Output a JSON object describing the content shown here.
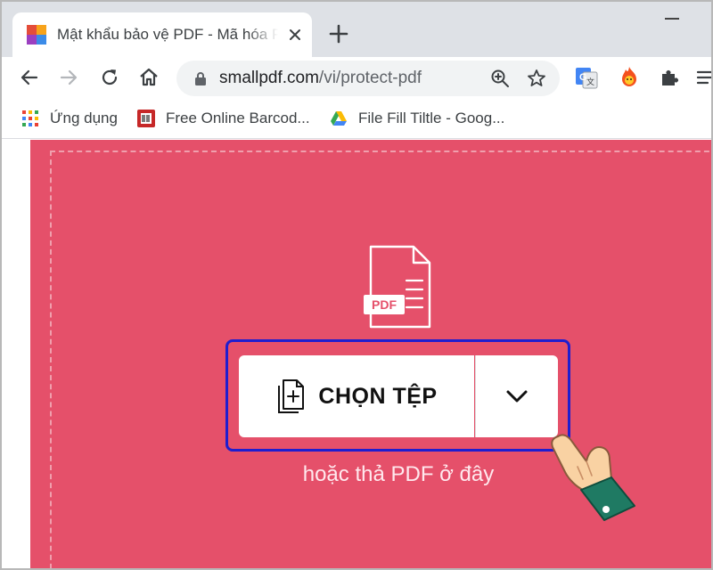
{
  "browser": {
    "tab": {
      "title": "Mật khẩu bảo vệ PDF - Mã hóa PDF"
    },
    "address_bar": {
      "url_host": "smallpdf.com",
      "url_path": "/vi/protect-pdf"
    },
    "bookmarks": [
      {
        "label": "Ứng dụng",
        "icon": "apps-grid-icon"
      },
      {
        "label": "Free Online Barcod...",
        "icon": "barcode-icon"
      },
      {
        "label": "File Fill Tiltle - Goog...",
        "icon": "google-drive-icon"
      }
    ]
  },
  "page": {
    "file_badge": "PDF",
    "choose_button": {
      "label": "CHỌN TỆP"
    },
    "drop_hint": "hoặc thả PDF ở đây"
  },
  "colors": {
    "accent": "#e5506a",
    "highlight_border": "#1e1ecf",
    "tab_strip": "#dee1e6",
    "omnibox": "#f1f3f4"
  }
}
